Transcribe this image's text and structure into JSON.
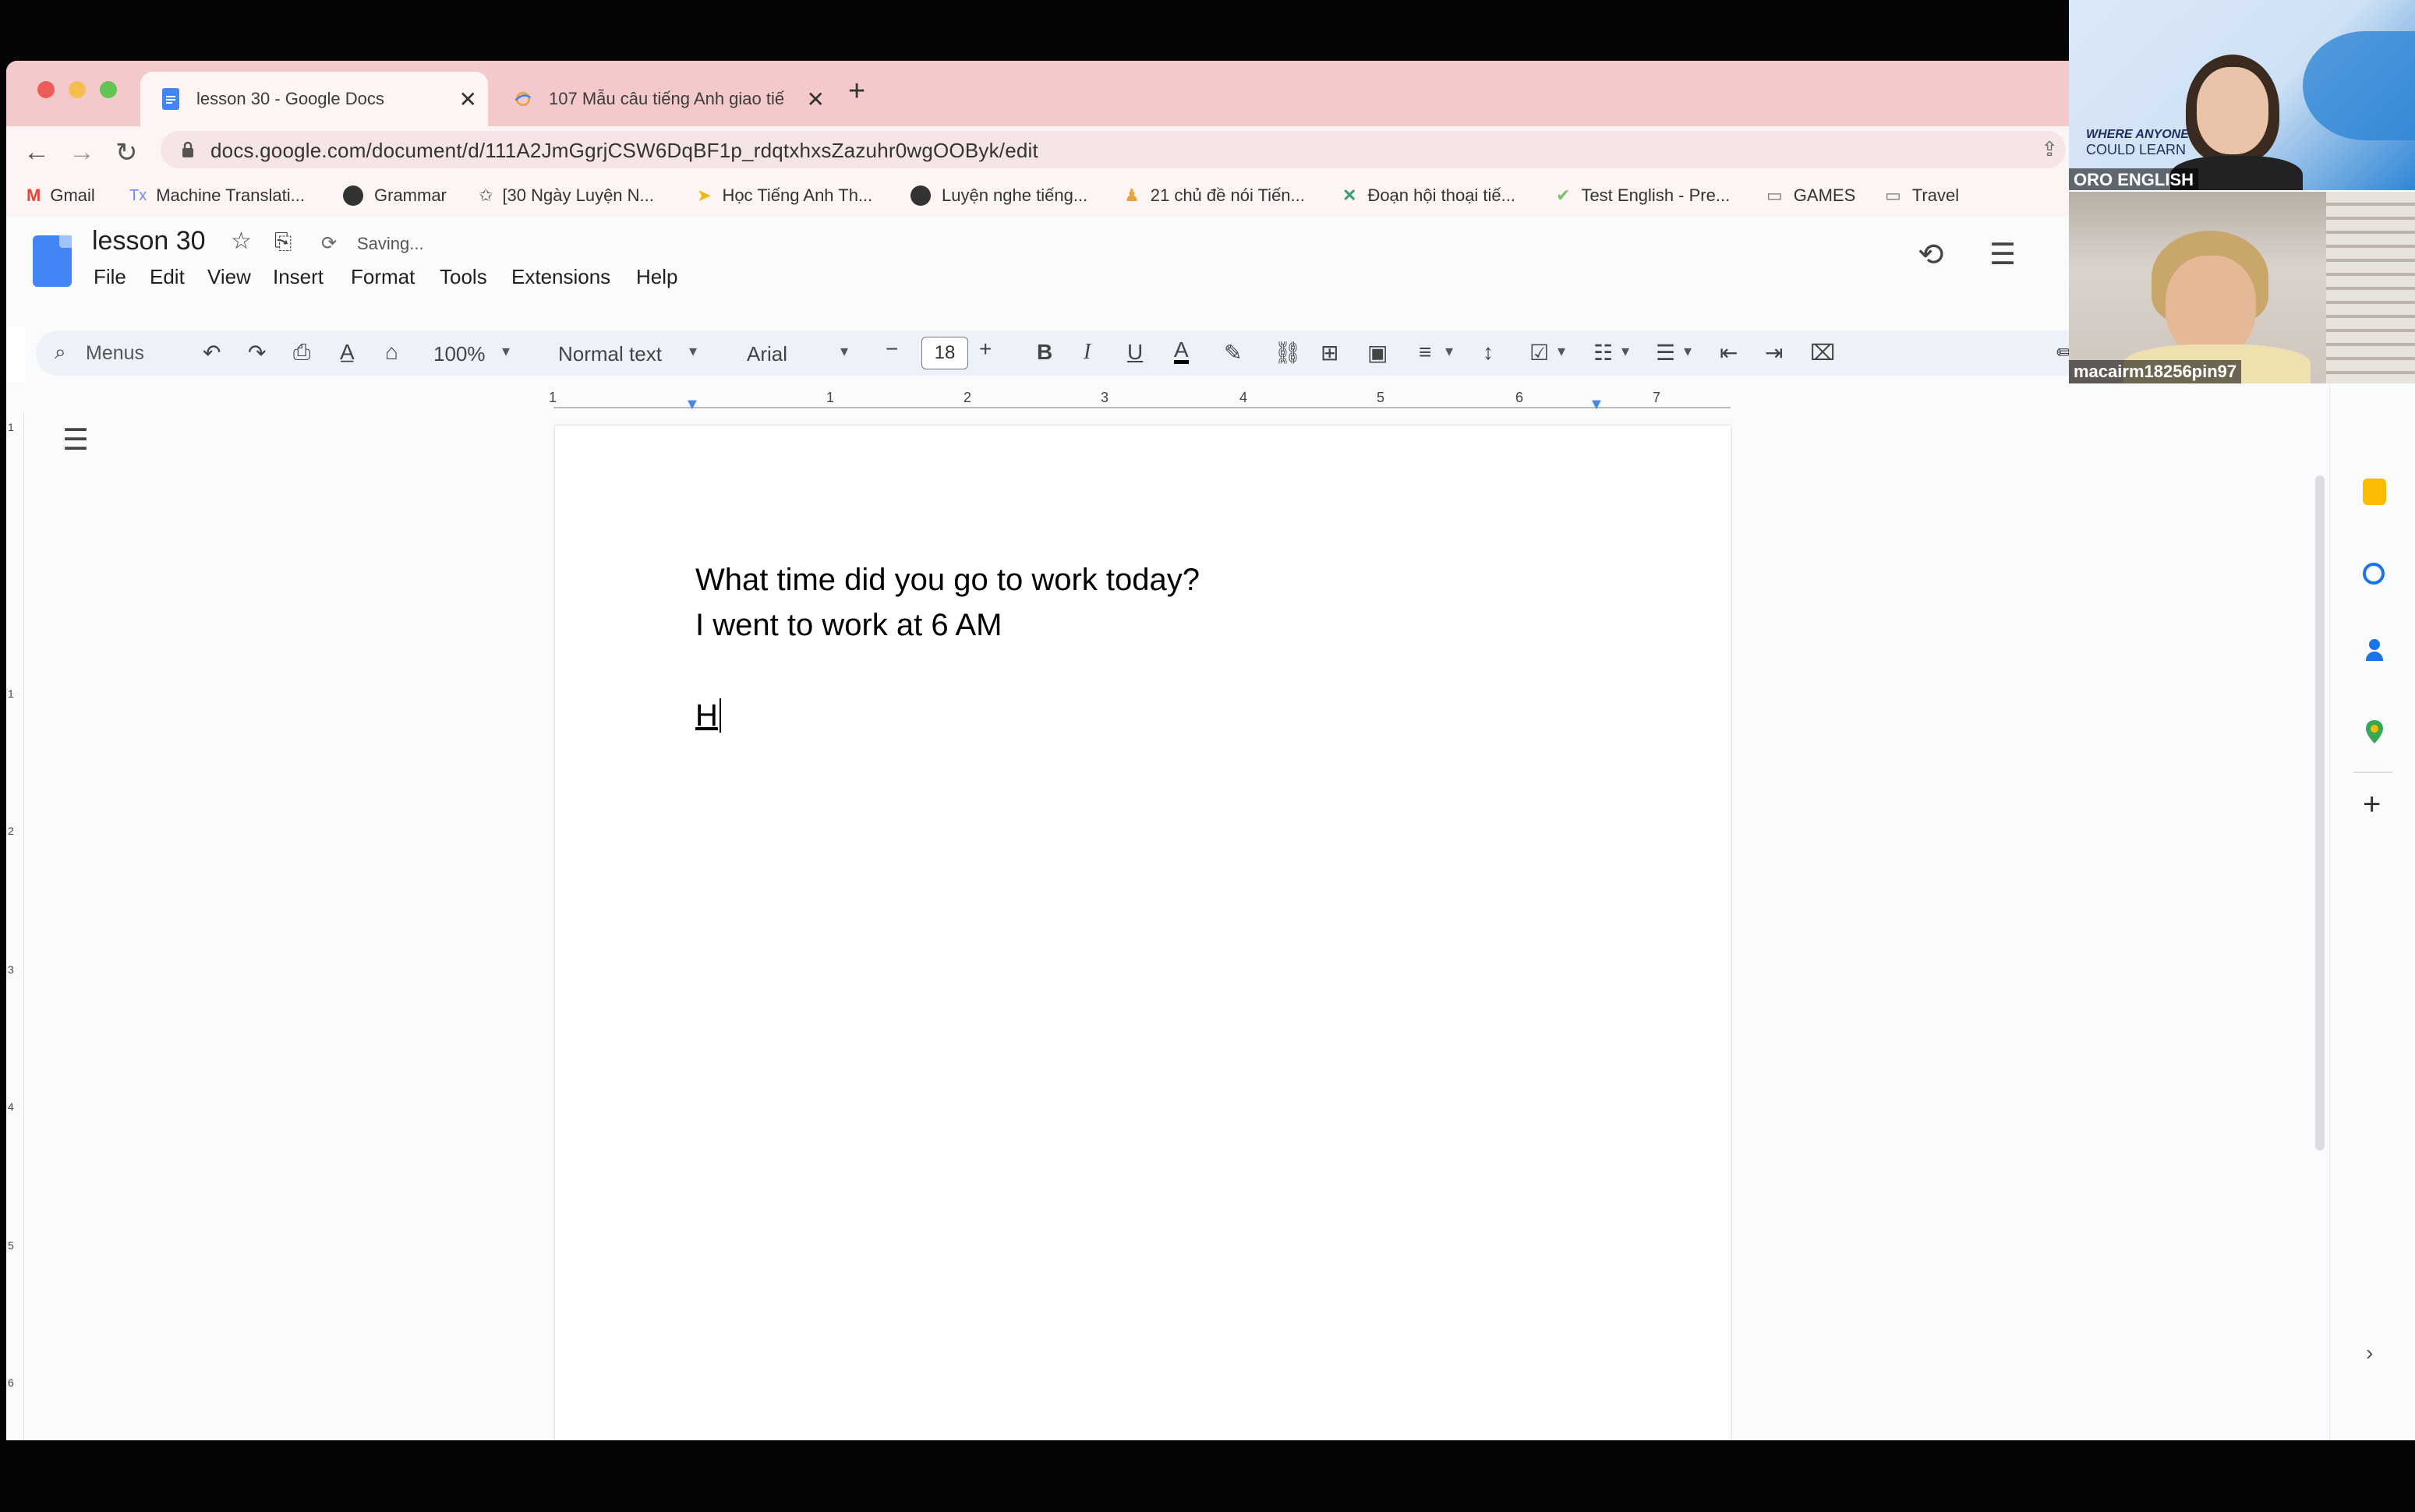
{
  "browser": {
    "tabs": [
      {
        "label": "lesson 30 - Google Docs",
        "icon": "google-docs-icon",
        "active": true
      },
      {
        "label": "107 Mẫu câu tiếng Anh giao tiế",
        "icon": "web-favicon",
        "active": false
      }
    ],
    "new_tab": "+",
    "url": "docs.google.com/document/d/111A2JmGgrjCSW6DqBF1p_rdqtxhxsZazuhr0wgOOByk/edit",
    "bookmarks": [
      {
        "label": "Gmail",
        "icon": "gmail-icon",
        "color": "#ea4335"
      },
      {
        "label": "Machine Translati...",
        "icon": "translate-icon",
        "color": "#6b8df5"
      },
      {
        "label": "Grammar",
        "icon": "globe-icon",
        "color": "#333333"
      },
      {
        "label": "[30 Ngày Luyện N...",
        "icon": "star-outline-icon",
        "color": "#555555"
      },
      {
        "label": "Học Tiếng Anh Th...",
        "icon": "arrow-icon",
        "color": "#f4b400"
      },
      {
        "label": "Luyện nghe tiếng...",
        "icon": "globe-icon",
        "color": "#333333"
      },
      {
        "label": "21 chủ đề nói Tiến...",
        "icon": "person-icon",
        "color": "#e8a33d"
      },
      {
        "label": "Đoạn hội thoại tiế...",
        "icon": "cross-icon",
        "color": "#3a9d6b"
      },
      {
        "label": "Test English - Pre...",
        "icon": "check-circle-icon",
        "color": "#7cc06b"
      },
      {
        "label": "GAMES",
        "icon": "folder-icon",
        "color": "#777777"
      },
      {
        "label": "Travel",
        "icon": "folder-icon",
        "color": "#777777"
      }
    ]
  },
  "docs": {
    "title": "lesson 30",
    "status": "Saving...",
    "menus": [
      "File",
      "Edit",
      "View",
      "Insert",
      "Format",
      "Tools",
      "Extensions",
      "Help"
    ],
    "toolbar": {
      "search_placeholder": "Menus",
      "zoom": "100%",
      "style": "Normal text",
      "font": "Arial",
      "font_size": "18"
    },
    "ruler_numbers": [
      "1",
      "1",
      "2",
      "3",
      "4",
      "5",
      "6",
      "7"
    ],
    "left_ruler_numbers": [
      "1",
      "1",
      "2",
      "3",
      "4",
      "5",
      "6"
    ],
    "content": {
      "line1": "What time did you go to work today?",
      "line2": "I went to work at 6 AM",
      "line3": "H"
    }
  },
  "video": {
    "tile1": {
      "brand_line1": "WHERE ANYONE",
      "brand_line2": "COULD LEARN",
      "label": "ORO ENGLISH"
    },
    "tile2": {
      "label": "macairm18256pin97"
    }
  }
}
